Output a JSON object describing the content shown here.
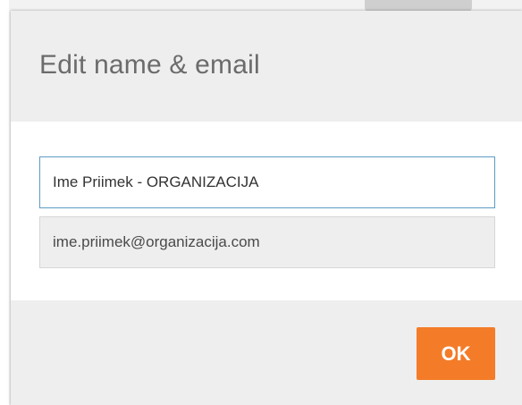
{
  "dialog": {
    "title": "Edit name & email",
    "name_field": {
      "value": "Ime Priimek - ORGANIZACIJA",
      "placeholder": ""
    },
    "email_field": {
      "value": "ime.priimek@organizacija.com",
      "placeholder": ""
    },
    "ok_label": "OK"
  },
  "colors": {
    "accent": "#f47c28",
    "focus_border": "#5d9cc4",
    "header_bg": "#eeeeee",
    "body_bg": "#ffffff"
  }
}
